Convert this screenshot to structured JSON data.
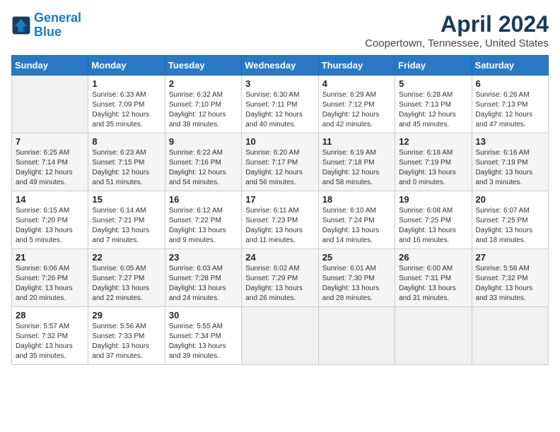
{
  "logo": {
    "line1": "General",
    "line2": "Blue"
  },
  "title": "April 2024",
  "location": "Coopertown, Tennessee, United States",
  "weekdays": [
    "Sunday",
    "Monday",
    "Tuesday",
    "Wednesday",
    "Thursday",
    "Friday",
    "Saturday"
  ],
  "weeks": [
    [
      {
        "day": "",
        "empty": true
      },
      {
        "day": "1",
        "rise": "6:33 AM",
        "set": "7:09 PM",
        "daylight": "12 hours and 35 minutes."
      },
      {
        "day": "2",
        "rise": "6:32 AM",
        "set": "7:10 PM",
        "daylight": "12 hours and 38 minutes."
      },
      {
        "day": "3",
        "rise": "6:30 AM",
        "set": "7:11 PM",
        "daylight": "12 hours and 40 minutes."
      },
      {
        "day": "4",
        "rise": "6:29 AM",
        "set": "7:12 PM",
        "daylight": "12 hours and 42 minutes."
      },
      {
        "day": "5",
        "rise": "6:28 AM",
        "set": "7:13 PM",
        "daylight": "12 hours and 45 minutes."
      },
      {
        "day": "6",
        "rise": "6:26 AM",
        "set": "7:13 PM",
        "daylight": "12 hours and 47 minutes."
      }
    ],
    [
      {
        "day": "7",
        "rise": "6:25 AM",
        "set": "7:14 PM",
        "daylight": "12 hours and 49 minutes."
      },
      {
        "day": "8",
        "rise": "6:23 AM",
        "set": "7:15 PM",
        "daylight": "12 hours and 51 minutes."
      },
      {
        "day": "9",
        "rise": "6:22 AM",
        "set": "7:16 PM",
        "daylight": "12 hours and 54 minutes."
      },
      {
        "day": "10",
        "rise": "6:20 AM",
        "set": "7:17 PM",
        "daylight": "12 hours and 56 minutes."
      },
      {
        "day": "11",
        "rise": "6:19 AM",
        "set": "7:18 PM",
        "daylight": "12 hours and 58 minutes."
      },
      {
        "day": "12",
        "rise": "6:18 AM",
        "set": "7:19 PM",
        "daylight": "13 hours and 0 minutes."
      },
      {
        "day": "13",
        "rise": "6:16 AM",
        "set": "7:19 PM",
        "daylight": "13 hours and 3 minutes."
      }
    ],
    [
      {
        "day": "14",
        "rise": "6:15 AM",
        "set": "7:20 PM",
        "daylight": "13 hours and 5 minutes."
      },
      {
        "day": "15",
        "rise": "6:14 AM",
        "set": "7:21 PM",
        "daylight": "13 hours and 7 minutes."
      },
      {
        "day": "16",
        "rise": "6:12 AM",
        "set": "7:22 PM",
        "daylight": "13 hours and 9 minutes."
      },
      {
        "day": "17",
        "rise": "6:11 AM",
        "set": "7:23 PM",
        "daylight": "13 hours and 11 minutes."
      },
      {
        "day": "18",
        "rise": "6:10 AM",
        "set": "7:24 PM",
        "daylight": "13 hours and 14 minutes."
      },
      {
        "day": "19",
        "rise": "6:08 AM",
        "set": "7:25 PM",
        "daylight": "13 hours and 16 minutes."
      },
      {
        "day": "20",
        "rise": "6:07 AM",
        "set": "7:25 PM",
        "daylight": "13 hours and 18 minutes."
      }
    ],
    [
      {
        "day": "21",
        "rise": "6:06 AM",
        "set": "7:26 PM",
        "daylight": "13 hours and 20 minutes."
      },
      {
        "day": "22",
        "rise": "6:05 AM",
        "set": "7:27 PM",
        "daylight": "13 hours and 22 minutes."
      },
      {
        "day": "23",
        "rise": "6:03 AM",
        "set": "7:28 PM",
        "daylight": "13 hours and 24 minutes."
      },
      {
        "day": "24",
        "rise": "6:02 AM",
        "set": "7:29 PM",
        "daylight": "13 hours and 26 minutes."
      },
      {
        "day": "25",
        "rise": "6:01 AM",
        "set": "7:30 PM",
        "daylight": "13 hours and 28 minutes."
      },
      {
        "day": "26",
        "rise": "6:00 AM",
        "set": "7:31 PM",
        "daylight": "13 hours and 31 minutes."
      },
      {
        "day": "27",
        "rise": "5:58 AM",
        "set": "7:32 PM",
        "daylight": "13 hours and 33 minutes."
      }
    ],
    [
      {
        "day": "28",
        "rise": "5:57 AM",
        "set": "7:32 PM",
        "daylight": "13 hours and 35 minutes."
      },
      {
        "day": "29",
        "rise": "5:56 AM",
        "set": "7:33 PM",
        "daylight": "13 hours and 37 minutes."
      },
      {
        "day": "30",
        "rise": "5:55 AM",
        "set": "7:34 PM",
        "daylight": "13 hours and 39 minutes."
      },
      {
        "day": "",
        "empty": true
      },
      {
        "day": "",
        "empty": true
      },
      {
        "day": "",
        "empty": true
      },
      {
        "day": "",
        "empty": true
      }
    ]
  ]
}
